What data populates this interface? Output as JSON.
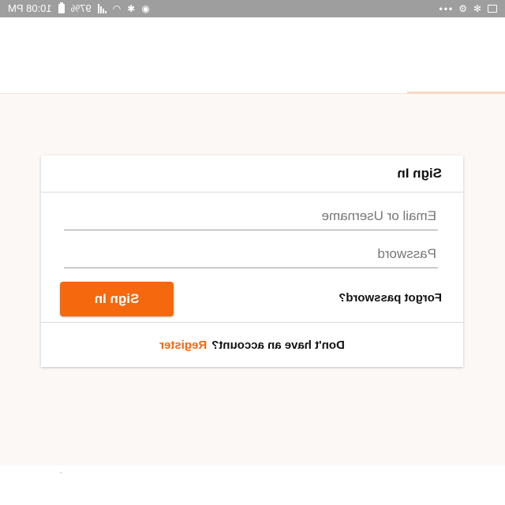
{
  "status_bar": {
    "time": "10:08 PM",
    "battery_percent": "97%",
    "overflow": "•••",
    "icons": [
      "image-icon",
      "fan-icon",
      "settings-icon",
      "location-icon",
      "bluetooth-icon",
      "wifi-icon",
      "signal-icon",
      "battery-icon"
    ]
  },
  "login_card": {
    "title": "Sign In",
    "email_placeholder": "Email or Username",
    "email_value": "",
    "password_placeholder": "Password",
    "password_value": "",
    "forgot_password": "Forgot password?",
    "sign_in_button": "Sign In",
    "no_account_text": "Don't have an account?",
    "register_link": "Register"
  },
  "colors": {
    "accent": "#f5680e",
    "status_bar": "#9e9e9e",
    "background": "#fbf8f6"
  }
}
